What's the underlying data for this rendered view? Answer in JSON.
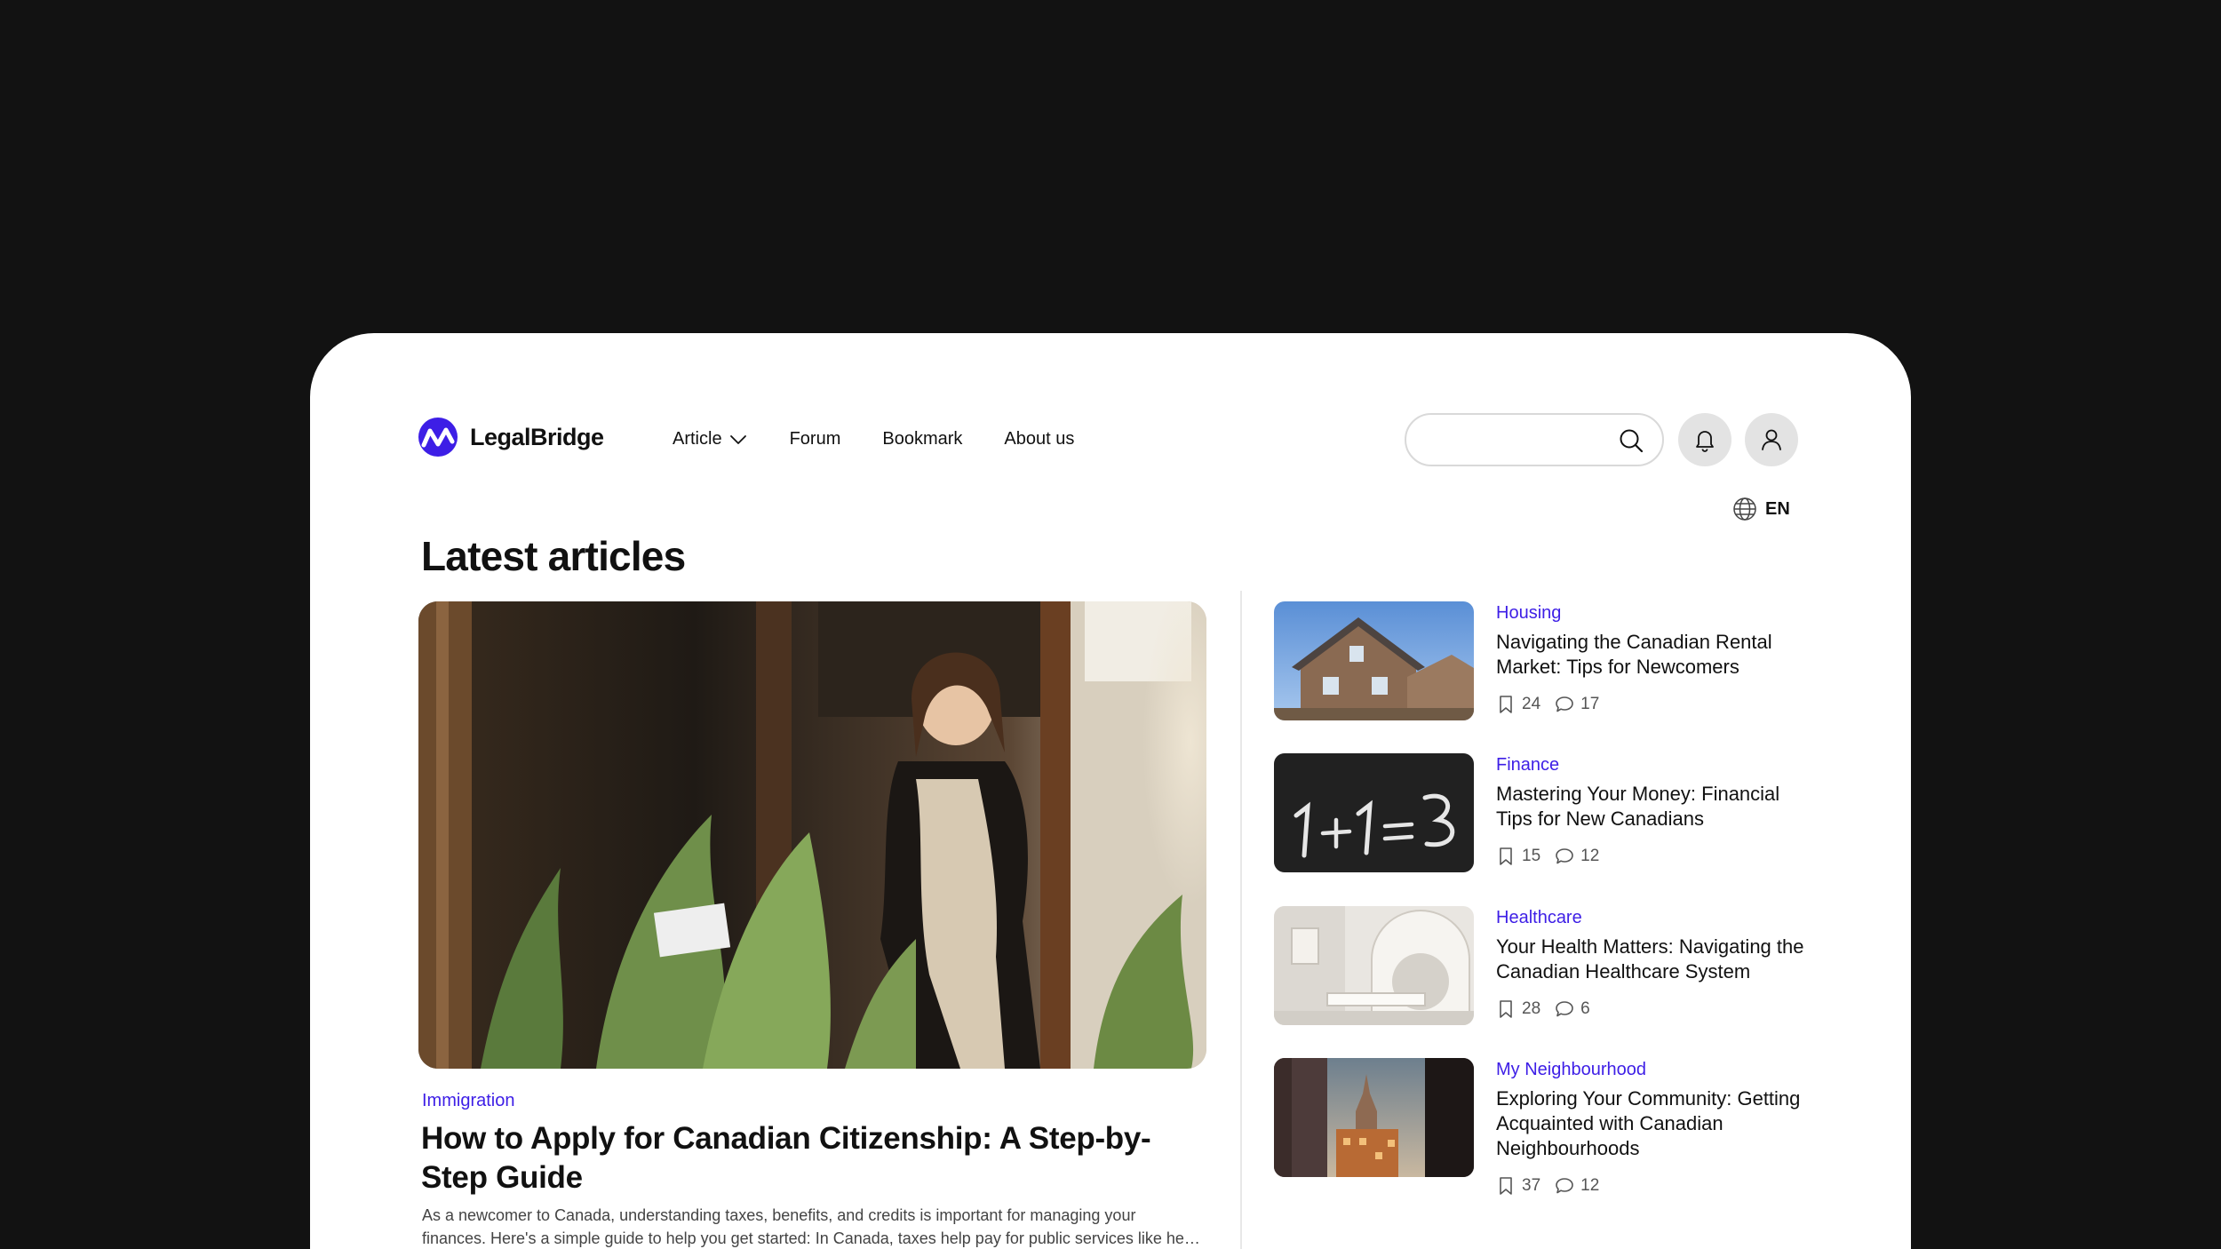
{
  "brand": {
    "name": "LegalBridge",
    "accent": "#3d1ee6"
  },
  "nav": {
    "article": "Article",
    "forum": "Forum",
    "bookmark": "Bookmark",
    "about": "About us"
  },
  "search": {
    "placeholder": "",
    "value": ""
  },
  "language": {
    "code": "EN"
  },
  "page": {
    "title": "Latest articles"
  },
  "featured": {
    "category": "Immigration",
    "title": "How to Apply for Canadian Citizenship: A Step-by-Step Guide",
    "excerpt_line1": "As a newcomer to Canada, understanding taxes, benefits, and credits is important for managing your",
    "excerpt_line2": "finances. Here's a simple guide to help you get started: In Canada, taxes help pay for public services like healthcare, education, and roads."
  },
  "articles": [
    {
      "category": "Housing",
      "title": "Navigating the Canadian Rental Market: Tips for Newcomers",
      "bookmarks": "24",
      "comments": "17"
    },
    {
      "category": "Finance",
      "title": "Mastering Your Money: Financial Tips for New Canadians",
      "bookmarks": "15",
      "comments": "12"
    },
    {
      "category": "Healthcare",
      "title": "Your Health Matters: Navigating the Canadian Healthcare System",
      "bookmarks": "28",
      "comments": "6"
    },
    {
      "category": "My Neighbourhood",
      "title": "Exploring Your Community: Getting Acquainted with Canadian Neighbourhoods",
      "bookmarks": "37",
      "comments": "12"
    }
  ],
  "icons": {
    "logo": "legalbridge-logo-icon",
    "article_menu": "chevron-down-icon",
    "search": "search-icon",
    "notifications": "bell-icon",
    "account": "user-icon",
    "language": "globe-icon",
    "bookmark": "bookmark-icon",
    "comment": "comment-icon"
  }
}
